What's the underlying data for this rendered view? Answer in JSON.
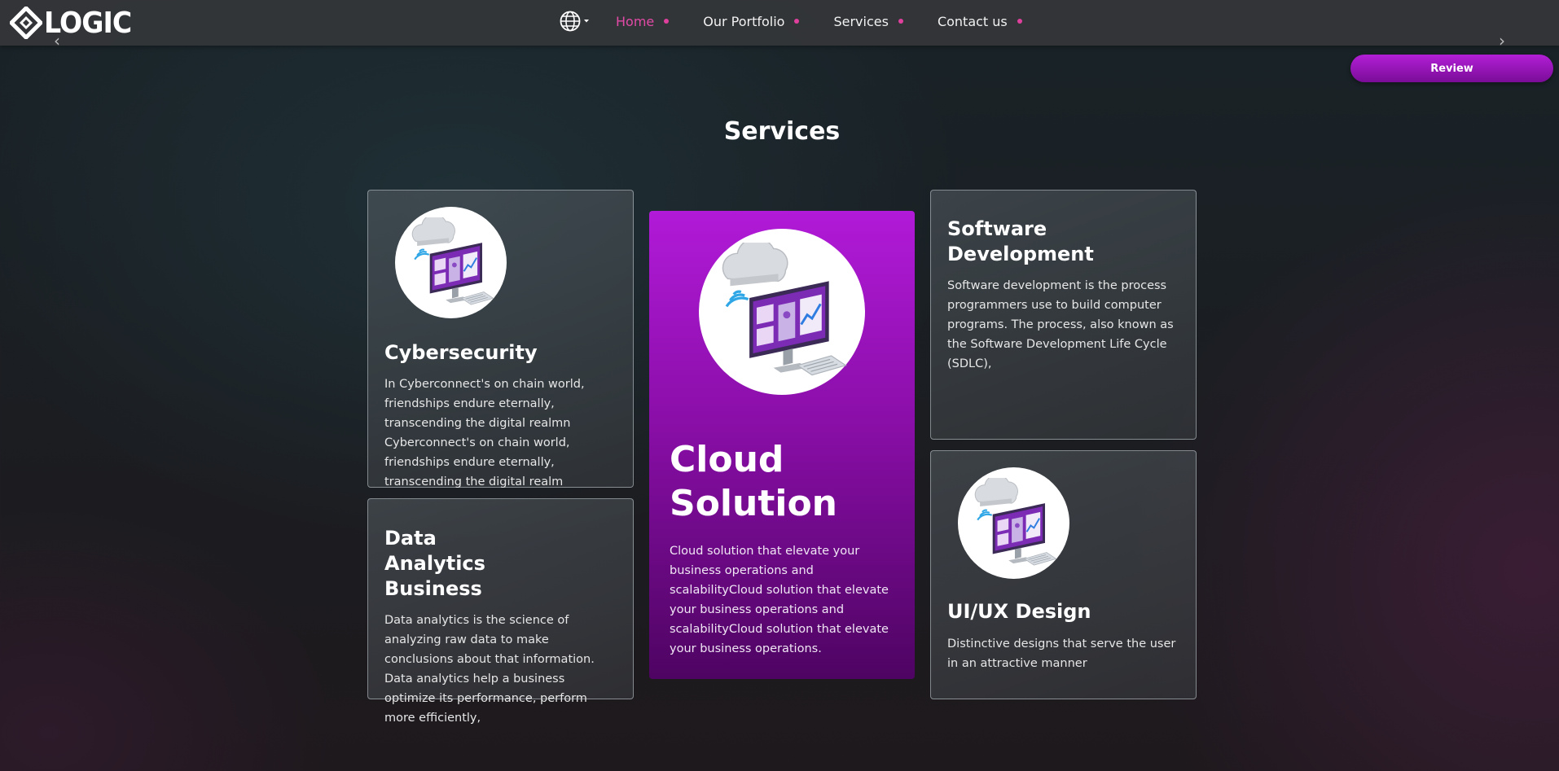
{
  "brand": {
    "logo_text": "LOGIC"
  },
  "nav": {
    "items": [
      {
        "label": "Home",
        "active": true
      },
      {
        "label": "Our Portfolio",
        "active": false
      },
      {
        "label": "Services",
        "active": false
      },
      {
        "label": "Contact us",
        "active": false
      }
    ],
    "active_color": "#e14aa6",
    "dot_color": "#e0409d"
  },
  "review_button": {
    "label": "Review"
  },
  "services": {
    "title": "Services",
    "cards": [
      {
        "title": "Cybersecurity",
        "description": "In Cyberconnect's on chain world, friendships endure eternally, transcending the digital realmn Cyberconnect's on chain world, friendships endure eternally, transcending the digital realm",
        "icon": "cloud-computer-icon"
      },
      {
        "title": "Data Analytics Business",
        "description": "Data analytics is the science of analyzing raw data to make conclusions about that information. Data analytics help a business optimize its performance, perform more efficiently,"
      },
      {
        "title": "Cloud Solution",
        "description": "Cloud solution that elevate your business operations and scalabilityCloud solution that elevate your business operations and scalabilityCloud solution that elevate your business operations.",
        "icon": "cloud-computer-icon",
        "accent": "#b11ad8"
      },
      {
        "title": "Software Development",
        "description": "Software development is the process programmers use to build computer programs. The process, also known as the Software Development Life Cycle (SDLC),"
      },
      {
        "title": "UI/UX Design",
        "description": "Distinctive designs that serve the user in an attractive manner",
        "icon": "cloud-computer-icon"
      }
    ]
  }
}
